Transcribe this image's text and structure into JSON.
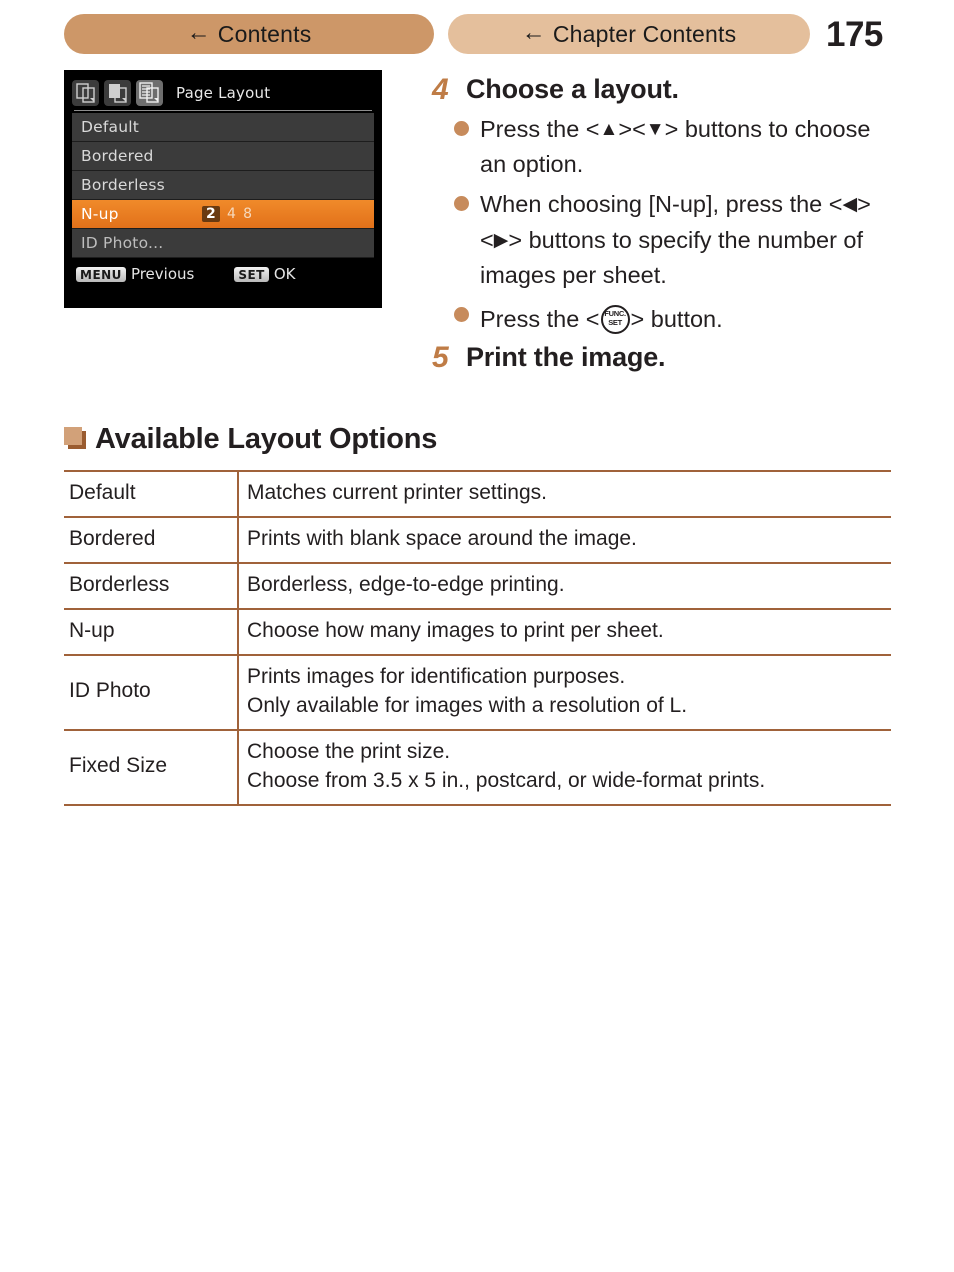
{
  "header": {
    "contents_button": {
      "label": "Contents",
      "icon": "back-arrow-icon",
      "arrow": "←",
      "color": "#cd9768"
    },
    "chapter_contents_button": {
      "label": "Chapter Contents",
      "icon": "back-arrow-icon",
      "arrow": "←",
      "color": "#e4bf9c"
    },
    "page_number": "175"
  },
  "camera_screen": {
    "tab_title": "Page Layout",
    "tabs": [
      {
        "name": "print-effect-tab",
        "active": false
      },
      {
        "name": "paper-settings-tab",
        "active": false
      },
      {
        "name": "page-layout-tab",
        "active": true
      }
    ],
    "menu_items": [
      {
        "label": "Default",
        "selected": false
      },
      {
        "label": "Bordered",
        "selected": false
      },
      {
        "label": "Borderless",
        "selected": false
      },
      {
        "label": "N-up",
        "selected": true,
        "values": [
          "2",
          "4",
          "8"
        ],
        "chosen_value": "2"
      },
      {
        "label": "ID Photo...",
        "selected": false
      }
    ],
    "footer": {
      "menu_key": "MENU",
      "menu_action": "Previous",
      "set_key": "SET",
      "set_action": "OK"
    },
    "highlight_color": "#e2711a"
  },
  "steps": [
    {
      "number": "4",
      "title": "Choose a layout.",
      "bullets": [
        {
          "parts": [
            "Press the <",
            "up-arrow",
            "><",
            "down-arrow",
            "> buttons to choose an option."
          ]
        },
        {
          "parts": [
            "When choosing [N-up], press the <",
            "left-arrow",
            "><",
            "right-arrow",
            "> buttons to specify the number of images per sheet."
          ]
        },
        {
          "parts": [
            "Press the <",
            "func-set",
            "> button."
          ]
        }
      ]
    },
    {
      "number": "5",
      "title": "Print the image.",
      "bullets": []
    }
  ],
  "bullet_text": {
    "b1_pre": "Press the <",
    "b1_mid": "><",
    "b1_post": "> buttons to",
    "b1_line2": "choose an option.",
    "b2_line1": "When choosing [N-up], press",
    "b2_line2_pre": "the <",
    "b2_line2_mid": "><",
    "b2_line2_post": "> buttons to specify",
    "b2_line3": "the number of images per sheet.",
    "b3_pre": "Press the <",
    "b3_post": "> button.",
    "func_label_top": "FUNC.",
    "func_label_bottom": "SET",
    "up_glyph": "▲",
    "down_glyph": "▼",
    "left_glyph": "◀",
    "right_glyph": "▶"
  },
  "section": {
    "icon": "square-bullet-icon",
    "title": "Available Layout Options",
    "accent_color": "#a0623a"
  },
  "table": {
    "rows": [
      {
        "option": "Default",
        "description": [
          "Matches current printer settings."
        ]
      },
      {
        "option": "Bordered",
        "description": [
          "Prints with blank space around the image."
        ]
      },
      {
        "option": "Borderless",
        "description": [
          "Borderless, edge-to-edge printing."
        ]
      },
      {
        "option": "N-up",
        "description": [
          "Choose how many images to print per sheet."
        ]
      },
      {
        "option": "ID Photo",
        "description": [
          "Prints images for identification purposes.",
          "Only available for images with a resolution of L."
        ]
      },
      {
        "option": "Fixed Size",
        "description": [
          "Choose the print size.",
          "Choose from 3.5 x 5 in., postcard, or wide-format prints."
        ]
      }
    ]
  }
}
